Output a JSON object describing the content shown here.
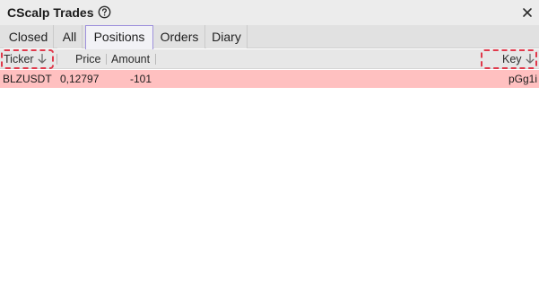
{
  "window": {
    "title": "CScalp Trades",
    "help_icon": "help-circle-icon",
    "close_icon": "close-icon"
  },
  "tabs": [
    {
      "label": "Closed",
      "active": false
    },
    {
      "label": "All",
      "active": false
    },
    {
      "label": "Positions",
      "active": true
    },
    {
      "label": "Orders",
      "active": false
    },
    {
      "label": "Diary",
      "active": false
    }
  ],
  "table": {
    "columns": {
      "ticker": "Ticker",
      "price": "Price",
      "amount": "Amount",
      "key": "Key"
    },
    "sort_icon": "arrow-down-icon",
    "rows": [
      {
        "ticker": "BLZUSDT",
        "price": "0,12797",
        "amount": "-101",
        "key": "pGg1i"
      }
    ]
  },
  "colors": {
    "row_highlight": "#ffc0c0",
    "active_tab_border": "#9f92dc",
    "dashed_highlight": "#e0394b"
  }
}
